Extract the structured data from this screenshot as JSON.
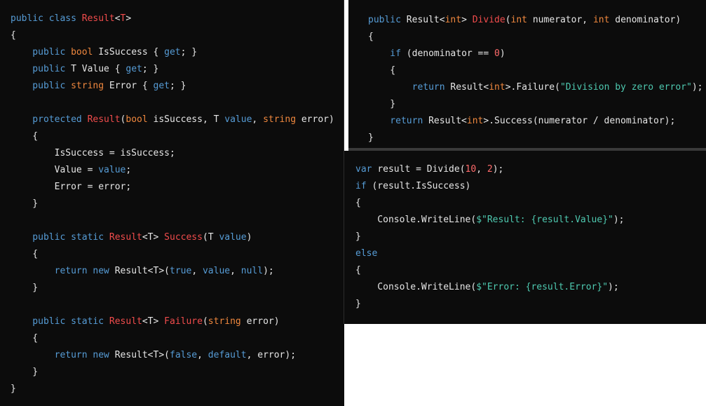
{
  "colors": {
    "background": "#0c0c0c",
    "plain": "#e6e6e6",
    "keyword": "#569cd6",
    "type_keyword": "#f0883e",
    "class_name": "#f14c4c",
    "number": "#ff6b6b",
    "string": "#4ec9b0",
    "separator": "#3a3a3a"
  },
  "panels": {
    "left": {
      "lines": [
        [
          [
            "public class ",
            "keyword"
          ],
          [
            "Result",
            "class_name"
          ],
          [
            "<",
            "plain"
          ],
          [
            "T",
            "class_name"
          ],
          [
            ">",
            "plain"
          ]
        ],
        [
          [
            "{",
            "plain"
          ]
        ],
        [
          [
            "    public ",
            "keyword"
          ],
          [
            "bool ",
            "type_keyword"
          ],
          [
            "IsSuccess { ",
            "plain"
          ],
          [
            "get",
            "keyword"
          ],
          [
            "; }",
            "plain"
          ]
        ],
        [
          [
            "    public ",
            "keyword"
          ],
          [
            "T Value { ",
            "plain"
          ],
          [
            "get",
            "keyword"
          ],
          [
            "; }",
            "plain"
          ]
        ],
        [
          [
            "    public ",
            "keyword"
          ],
          [
            "string ",
            "type_keyword"
          ],
          [
            "Error { ",
            "plain"
          ],
          [
            "get",
            "keyword"
          ],
          [
            "; }",
            "plain"
          ]
        ],
        [],
        [
          [
            "    protected ",
            "keyword"
          ],
          [
            "Result",
            "class_name"
          ],
          [
            "(",
            "plain"
          ],
          [
            "bool ",
            "type_keyword"
          ],
          [
            "isSuccess, T ",
            "plain"
          ],
          [
            "value",
            "keyword"
          ],
          [
            ", ",
            "plain"
          ],
          [
            "string ",
            "type_keyword"
          ],
          [
            "error)",
            "plain"
          ]
        ],
        [
          [
            "    {",
            "plain"
          ]
        ],
        [
          [
            "        IsSuccess = isSuccess;",
            "plain"
          ]
        ],
        [
          [
            "        Value = ",
            "plain"
          ],
          [
            "value",
            "keyword"
          ],
          [
            ";",
            "plain"
          ]
        ],
        [
          [
            "        Error = error;",
            "plain"
          ]
        ],
        [
          [
            "    }",
            "plain"
          ]
        ],
        [],
        [
          [
            "    public static ",
            "keyword"
          ],
          [
            "Result",
            "class_name"
          ],
          [
            "<T> ",
            "plain"
          ],
          [
            "Success",
            "class_name"
          ],
          [
            "(T ",
            "plain"
          ],
          [
            "value",
            "keyword"
          ],
          [
            ")",
            "plain"
          ]
        ],
        [
          [
            "    {",
            "plain"
          ]
        ],
        [
          [
            "        return new ",
            "keyword"
          ],
          [
            "Result<T>(",
            "plain"
          ],
          [
            "true",
            "keyword"
          ],
          [
            ", ",
            "plain"
          ],
          [
            "value",
            "keyword"
          ],
          [
            ", ",
            "plain"
          ],
          [
            "null",
            "keyword"
          ],
          [
            ");",
            "plain"
          ]
        ],
        [
          [
            "    }",
            "plain"
          ]
        ],
        [],
        [
          [
            "    public static ",
            "keyword"
          ],
          [
            "Result",
            "class_name"
          ],
          [
            "<T> ",
            "plain"
          ],
          [
            "Failure",
            "class_name"
          ],
          [
            "(",
            "plain"
          ],
          [
            "string ",
            "type_keyword"
          ],
          [
            "error)",
            "plain"
          ]
        ],
        [
          [
            "    {",
            "plain"
          ]
        ],
        [
          [
            "        return new ",
            "keyword"
          ],
          [
            "Result<T>(",
            "plain"
          ],
          [
            "false",
            "keyword"
          ],
          [
            ", ",
            "plain"
          ],
          [
            "default",
            "keyword"
          ],
          [
            ", error);",
            "plain"
          ]
        ],
        [
          [
            "    }",
            "plain"
          ]
        ],
        [
          [
            "}",
            "plain"
          ]
        ]
      ]
    },
    "top_right": {
      "lines": [
        [
          [
            "public ",
            "keyword"
          ],
          [
            "Result<",
            "plain"
          ],
          [
            "int",
            "type_keyword"
          ],
          [
            "> ",
            "plain"
          ],
          [
            "Divide",
            "class_name"
          ],
          [
            "(",
            "plain"
          ],
          [
            "int ",
            "type_keyword"
          ],
          [
            "numerator, ",
            "plain"
          ],
          [
            "int ",
            "type_keyword"
          ],
          [
            "denominator)",
            "plain"
          ]
        ],
        [
          [
            "{",
            "plain"
          ]
        ],
        [
          [
            "    if ",
            "keyword"
          ],
          [
            "(denominator == ",
            "plain"
          ],
          [
            "0",
            "number"
          ],
          [
            ")",
            "plain"
          ]
        ],
        [
          [
            "    {",
            "plain"
          ]
        ],
        [
          [
            "        return ",
            "keyword"
          ],
          [
            "Result<",
            "plain"
          ],
          [
            "int",
            "type_keyword"
          ],
          [
            ">.Failure(",
            "plain"
          ],
          [
            "\"Division by zero error\"",
            "string"
          ],
          [
            ");",
            "plain"
          ]
        ],
        [
          [
            "    }",
            "plain"
          ]
        ],
        [
          [
            "    return ",
            "keyword"
          ],
          [
            "Result<",
            "plain"
          ],
          [
            "int",
            "type_keyword"
          ],
          [
            ">.Success(numerator / denominator);",
            "plain"
          ]
        ],
        [
          [
            "}",
            "plain"
          ]
        ]
      ]
    },
    "bottom_right": {
      "lines": [
        [
          [
            "var ",
            "keyword"
          ],
          [
            "result = Divide(",
            "plain"
          ],
          [
            "10",
            "number"
          ],
          [
            ", ",
            "plain"
          ],
          [
            "2",
            "number"
          ],
          [
            ");",
            "plain"
          ]
        ],
        [
          [
            "if ",
            "keyword"
          ],
          [
            "(result.IsSuccess)",
            "plain"
          ]
        ],
        [
          [
            "{",
            "plain"
          ]
        ],
        [
          [
            "    Console.WriteLine(",
            "plain"
          ],
          [
            "$\"Result: {result.Value}\"",
            "string"
          ],
          [
            ");",
            "plain"
          ]
        ],
        [
          [
            "}",
            "plain"
          ]
        ],
        [
          [
            "else",
            "keyword"
          ]
        ],
        [
          [
            "{",
            "plain"
          ]
        ],
        [
          [
            "    Console.WriteLine(",
            "plain"
          ],
          [
            "$\"Error: {result.Error}\"",
            "string"
          ],
          [
            ");",
            "plain"
          ]
        ],
        [
          [
            "}",
            "plain"
          ]
        ]
      ]
    }
  }
}
